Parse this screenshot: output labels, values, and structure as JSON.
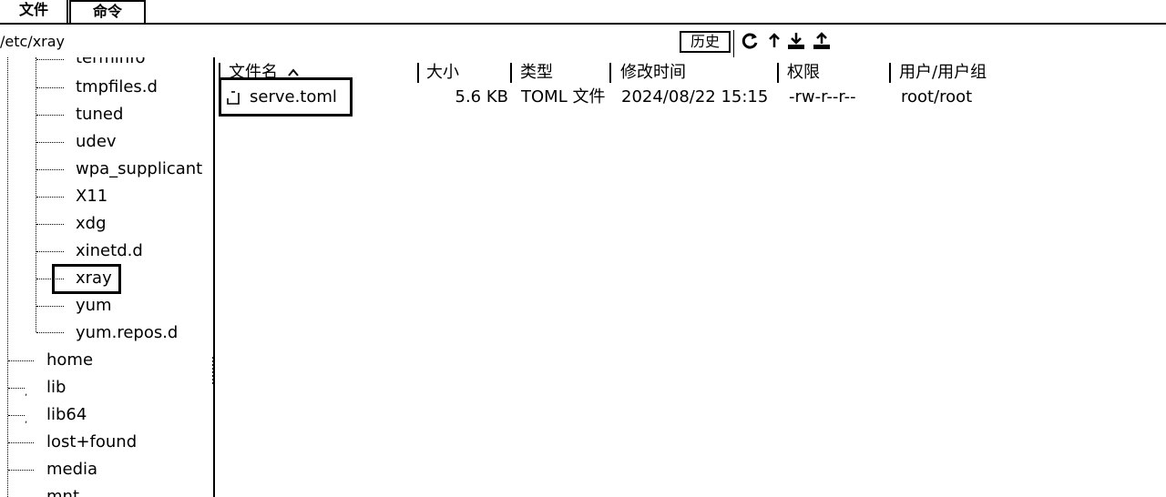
{
  "tabs": {
    "files": "文件",
    "command": "命令"
  },
  "path": {
    "current": "/etc/xray",
    "history_label": "历史"
  },
  "toolbar": {
    "icons": [
      "refresh-icon",
      "go-up-icon",
      "download-icon",
      "upload-icon"
    ]
  },
  "tree": {
    "child_items": [
      "terminfo",
      "tmpfiles.d",
      "tuned",
      "udev",
      "wpa_supplicant",
      "X11",
      "xdg",
      "xinetd.d",
      "xray",
      "yum",
      "yum.repos.d"
    ],
    "root_items": [
      "home",
      "lib",
      "lib64",
      "lost+found",
      "media",
      "mnt"
    ],
    "selected": "xray"
  },
  "file_list": {
    "columns": [
      "文件名",
      "大小",
      "类型",
      "修改时间",
      "权限",
      "用户/用户组"
    ],
    "sort_column": "文件名",
    "rows": [
      {
        "name": "serve.toml",
        "size": "5.6 KB",
        "type": "TOML 文件",
        "modified": "2024/08/22 15:15",
        "permissions": "-rw-r--r--",
        "owner": "root/root"
      }
    ]
  }
}
